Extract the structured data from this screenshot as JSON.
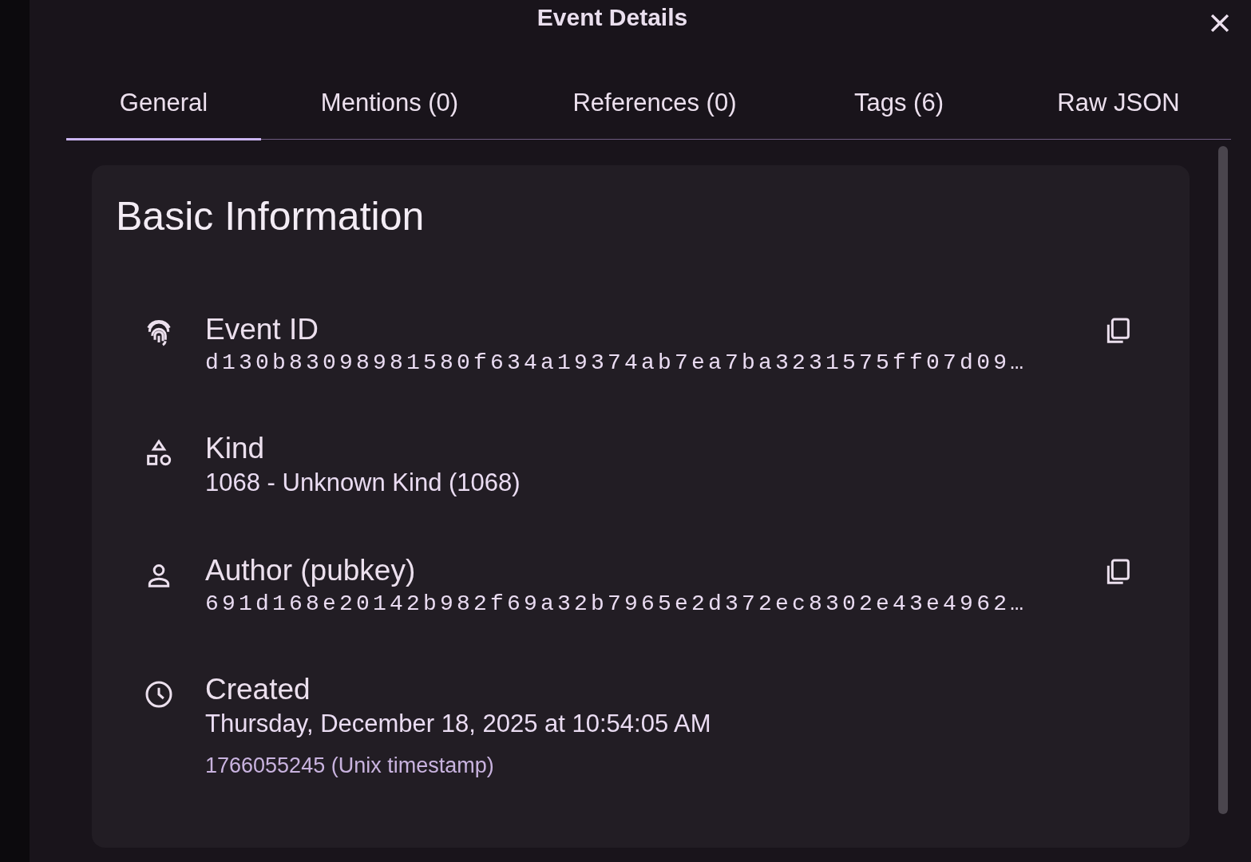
{
  "dialog": {
    "title": "Event Details"
  },
  "tabs": [
    {
      "label": "General",
      "selected": true
    },
    {
      "label": "Mentions (0)",
      "selected": false
    },
    {
      "label": "References (0)",
      "selected": false
    },
    {
      "label": "Tags (6)",
      "selected": false
    },
    {
      "label": "Raw JSON",
      "selected": false
    }
  ],
  "card": {
    "title": "Basic Information",
    "rows": [
      {
        "kind": "id",
        "label": "Event ID",
        "value": "d130b83098981580f634a19374ab7ea7ba3231575ff07d09…",
        "mono": true,
        "copyable": true
      },
      {
        "kind": "kind",
        "label": "Kind",
        "value": "1068 - Unknown Kind (1068)",
        "mono": false,
        "copyable": false
      },
      {
        "kind": "author",
        "label": "Author (pubkey)",
        "value": "691d168e20142b982f69a32b7965e2d372ec8302e43e4962…",
        "mono": true,
        "copyable": true
      },
      {
        "kind": "created",
        "label": "Created",
        "value": "Thursday, December 18, 2025 at 10:54:05 AM",
        "note": "1766055245 (Unix timestamp)",
        "mono": false,
        "copyable": false
      }
    ]
  }
}
